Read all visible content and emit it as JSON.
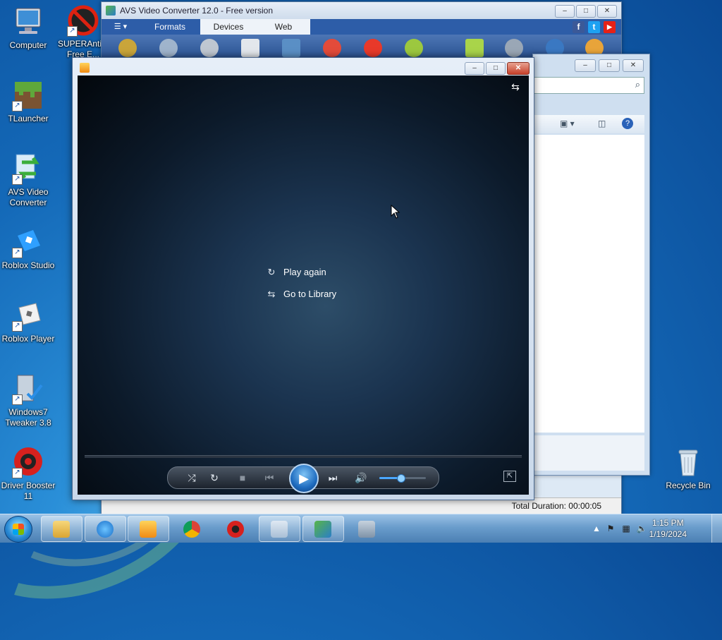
{
  "desktop": {
    "icons": [
      {
        "label": "Computer"
      },
      {
        "label": "SUPERAnti... Free E..."
      },
      {
        "label": "TLauncher"
      },
      {
        "label": "AVS Video Converter"
      },
      {
        "label": "Roblox Studio"
      },
      {
        "label": "Roblox Player"
      },
      {
        "label": "Windows7 Tweaker 3.8"
      },
      {
        "label": "Driver Booster 11"
      },
      {
        "label": "Recycle Bin"
      }
    ]
  },
  "avs": {
    "title": "AVS Video Converter 12.0 - Free version",
    "tabs": [
      "Formats",
      "Devices",
      "Web"
    ],
    "status": "Total Duration: 00:00:05",
    "social": [
      "f",
      "t",
      "▶"
    ]
  },
  "player": {
    "menu": {
      "play_again": "Play again",
      "go_to_library": "Go to Library"
    },
    "volume_level": 0.45
  },
  "taskbar": {
    "time": "1:15 PM",
    "date": "1/19/2024"
  },
  "window_controls": {
    "minimize": "–",
    "maximize": "□",
    "close": "✕"
  }
}
